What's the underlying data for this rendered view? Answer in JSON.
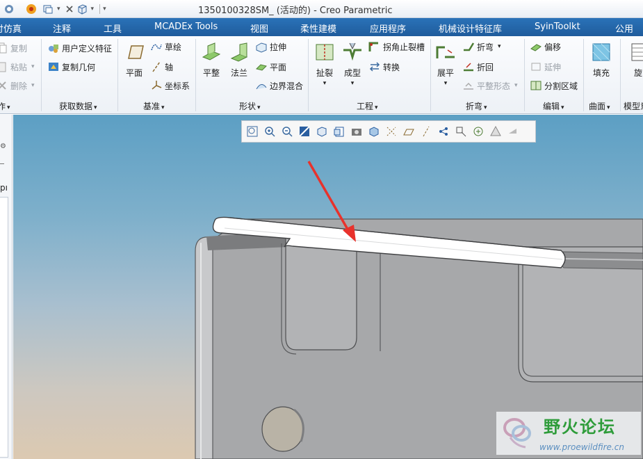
{
  "window": {
    "title": "1350100328SM_ (活动的) - Creo Parametric"
  },
  "quick_access": [
    "app-icon",
    "regenerate-icon",
    "window-icon",
    "close-window-icon",
    "view-cube-icon",
    "customize-dropdown-icon"
  ],
  "menu_tabs": [
    {
      "label": "讨仿真"
    },
    {
      "label": "注释"
    },
    {
      "label": "工具"
    },
    {
      "label": "MCADEx Tools"
    },
    {
      "label": "视图"
    },
    {
      "label": "柔性建模"
    },
    {
      "label": "应用程序"
    },
    {
      "label": "机械设计特征库"
    },
    {
      "label": "SyinToolkt"
    },
    {
      "label": "公用"
    }
  ],
  "ribbon": {
    "operations": {
      "copy": "复制",
      "paste": "粘贴",
      "delete": "删除",
      "label": "作"
    },
    "get_data": {
      "user_defined_feature": "用户定义特征",
      "copy_geometry": "复制几何",
      "label": "获取数据"
    },
    "datum": {
      "plane": "平面",
      "sketch": "草绘",
      "axis": "轴",
      "csys": "坐标系",
      "label": "基准"
    },
    "shapes": {
      "planar": "平整",
      "flange": "法兰",
      "extrude": "拉伸",
      "plane": "平面",
      "boundary_blend": "边界混合",
      "label": "形状"
    },
    "engineering": {
      "rip": "扯裂",
      "form": "成型",
      "corner_relief": "拐角止裂槽",
      "convert": "转换",
      "label": "工程"
    },
    "bends": {
      "unbend": "展平",
      "bend": "折弯",
      "bend_back": "折回",
      "flatten_form": "平整形态",
      "label": "折弯"
    },
    "editing": {
      "offset": "偏移",
      "extend": "延伸",
      "split_area": "分割区域",
      "label": "编辑"
    },
    "surfaces": {
      "fill": "填充",
      "label": "曲面"
    },
    "model_intent": {
      "rotate": "旋",
      "label": "模型意"
    }
  },
  "left_panel": {
    "text": "pı"
  },
  "view_toolbar": [
    "refit-icon",
    "zoom-in-icon",
    "zoom-out-icon",
    "repaint-icon",
    "display-style-icon",
    "saved-orientations-icon",
    "view-manager-icon",
    "perspective-icon",
    "datum-display-icon",
    "plane-display-icon",
    "axis-display-icon",
    "point-display-icon",
    "csys-display-icon",
    "spin-center-icon",
    "annotation-display-icon",
    "appearance-icon"
  ],
  "watermark": {
    "title": "野火论坛",
    "url": "www.proewildfire.cn"
  },
  "colors": {
    "tab_bar": "#1f5c9c",
    "arrow": "#e8322c",
    "part": "#a9a9aa"
  }
}
